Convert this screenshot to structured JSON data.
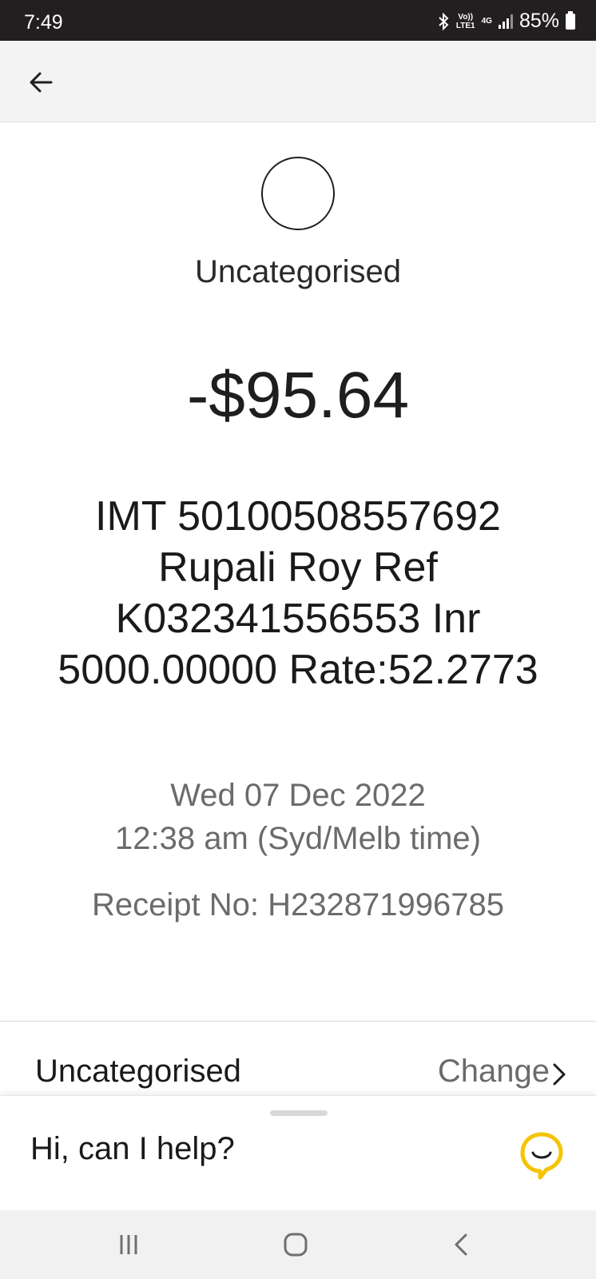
{
  "status_bar": {
    "time": "7:49",
    "network_top": "Vo))",
    "network_bottom": "LTE1",
    "network_type": "4G",
    "battery": "85%",
    "icons": [
      "bluetooth-icon",
      "signal-icon",
      "battery-icon"
    ]
  },
  "transaction": {
    "category": "Uncategorised",
    "amount": "-$95.64",
    "description": "IMT 50100508557692 Rupali Roy Ref K032341556553 Inr 5000.00000 Rate:52.2773",
    "date": "Wed 07 Dec 2022",
    "time": "12:38 am (Syd/Melb time)",
    "receipt": "Receipt No: H232871996785"
  },
  "category_row": {
    "label": "Uncategorised",
    "action": "Change"
  },
  "help": {
    "prompt": "Hi, can I help?"
  },
  "colors": {
    "accent": "#f5c400",
    "status_bar": "#231f20",
    "muted_text": "#6b6b6b"
  }
}
